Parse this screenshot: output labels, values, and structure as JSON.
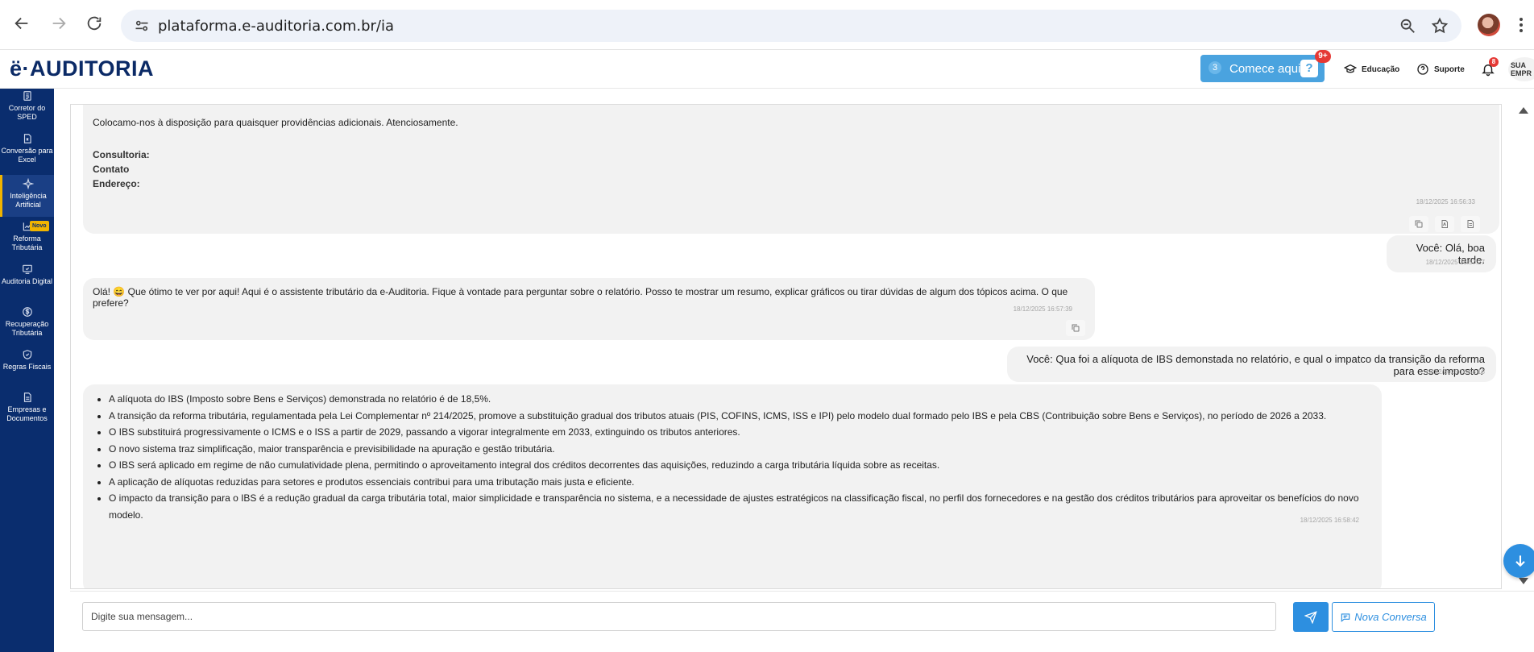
{
  "browser": {
    "url": "plataforma.e-auditoria.com.br/ia"
  },
  "header": {
    "logo": "ë·AUDITORIA",
    "comece": {
      "count": "3",
      "label": "Comece aqui",
      "badge": "9+"
    },
    "educacao": "Educação",
    "suporte": "Suporte",
    "bell_badge": "8",
    "company": "SUA EMPR"
  },
  "sidebar": {
    "items": [
      {
        "label": "Corretor do SPED",
        "icon": "document-check-icon"
      },
      {
        "label": "Conversão para Excel",
        "icon": "excel-file-icon"
      },
      {
        "label": "Inteligência Artificial",
        "icon": "sparkle-icon",
        "active": true
      },
      {
        "label": "Reforma Tributária",
        "icon": "chart-icon",
        "badge": "Novo"
      },
      {
        "label": "Auditoria Digital",
        "icon": "monitor-check-icon"
      },
      {
        "label": "Recuperação Tributária",
        "icon": "dollar-icon"
      },
      {
        "label": "Regras Fiscais",
        "icon": "shield-icon"
      },
      {
        "label": "Empresas e Documentos",
        "icon": "file-icon"
      }
    ]
  },
  "chat": {
    "msg1": {
      "text": "Colocamo-nos à disposição para quaisquer providências adicionais. Atenciosamente.",
      "consultoria": "Consultoria:",
      "contato": "Contato",
      "endereco": "Endereço:",
      "time": "18/12/2025 16:56:33"
    },
    "user1": {
      "text": "Você: Olá, boa tarde.",
      "time": "18/12/2025 16:57:27"
    },
    "ai2": {
      "text": "Olá! 😄 Que ótimo te ver por aqui! Aqui é o assistente tributário da e-Auditoria. Fique à vontade para perguntar sobre o relatório. Posso te mostrar um resumo, explicar gráficos ou tirar dúvidas de algum dos tópicos acima. O que prefere?",
      "time": "18/12/2025 16:57:39"
    },
    "user2": {
      "text": "Você: Qua foi a alíquota de IBS demonstada no relatório, e qual o impatco da transição da reforma para esse imposto?",
      "time": "18/12/2025 16:58:16"
    },
    "ai3": {
      "items": [
        "A alíquota do IBS (Imposto sobre Bens e Serviços) demonstrada no relatório é de 18,5%.",
        "A transição da reforma tributária, regulamentada pela Lei Complementar nº 214/2025, promove a substituição gradual dos tributos atuais (PIS, COFINS, ICMS, ISS e IPI) pelo modelo dual formado pelo IBS e pela CBS (Contribuição sobre Bens e Serviços), no período de 2026 a 2033.",
        "O IBS substituirá progressivamente o ICMS e o ISS a partir de 2029, passando a vigorar integralmente em 2033, extinguindo os tributos anteriores.",
        "O novo sistema traz simplificação, maior transparência e previsibilidade na apuração e gestão tributária.",
        "O IBS será aplicado em regime de não cumulatividade plena, permitindo o aproveitamento integral dos créditos decorrentes das aquisições, reduzindo a carga tributária líquida sobre as receitas.",
        "A aplicação de alíquotas reduzidas para setores e produtos essenciais contribui para uma tributação mais justa e eficiente.",
        "O impacto da transição para o IBS é a redução gradual da carga tributária total, maior simplicidade e transparência no sistema, e a necessidade de ajustes estratégicos na classificação fiscal, no perfil dos fornecedores e na gestão dos créditos tributários para aproveitar os benefícios do novo modelo."
      ],
      "time": "18/12/2025 16:58:42"
    }
  },
  "input": {
    "placeholder": "Digite sua mensagem...",
    "new_conversation": "Nova Conversa"
  }
}
